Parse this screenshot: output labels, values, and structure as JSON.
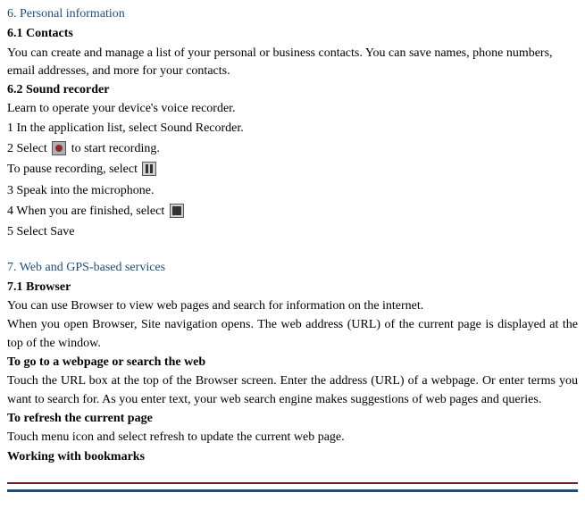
{
  "sec6": {
    "title": "6. Personal information",
    "s61": {
      "heading": "6.1 Contacts",
      "body": "You can create and manage a list of your personal or business contacts. You can save names, phone numbers, email addresses, and more for your contacts."
    },
    "s62": {
      "heading": "6.2 Sound recorder",
      "intro": "Learn to operate your device's voice recorder.",
      "step1": "1 In the application list, select Sound Recorder.",
      "step2a": "2 Select ",
      "step2b": " to start recording.",
      "pauseA": "  To pause recording, select ",
      "step3": "3 Speak into the microphone.",
      "step4a": "4 When you are finished, select ",
      "step5": "5 Select Save"
    }
  },
  "sec7": {
    "title": "7. Web and GPS-based services",
    "s71": {
      "heading": "7.1 Browser",
      "p1": "You can use Browser to view web pages and search for information on the internet.",
      "p2": "When you open Browser, Site navigation opens. The web address (URL) of the current page is displayed at the top of the window.",
      "h_goto": "To go to a webpage or search the web",
      "p_goto": "Touch the URL box at the top of the Browser screen. Enter the address (URL) of a webpage. Or enter terms you want to search for. As you enter text, your web search engine makes suggestions of web pages and queries.",
      "h_refresh": "To refresh the current page",
      "p_refresh": "Touch menu icon and select refresh to update the current web page.",
      "h_bookmarks": "Working with bookmarks"
    }
  }
}
